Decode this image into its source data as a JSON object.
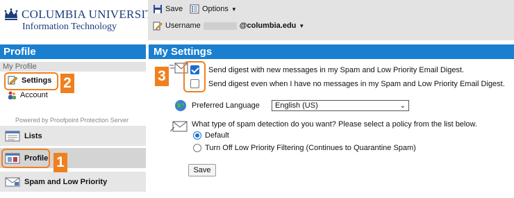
{
  "logo": {
    "university": "COLUMBIA UNIVERSITY",
    "department": "Information Technology",
    "icon": "crown-icon"
  },
  "toolbar": {
    "save_label": "Save",
    "options_label": "Options",
    "username_label": "Username",
    "username_domain": "columbia.edu"
  },
  "sidebar": {
    "header": "Profile",
    "section_label": "My Profile",
    "items": [
      {
        "label": "Settings",
        "icon": "wrench-pencil-icon"
      },
      {
        "label": "Account",
        "icon": "people-icon"
      }
    ],
    "powered_by": "Powered by Proofpoint Protection Server",
    "nav": [
      {
        "label": "Lists",
        "icon": "list-icon"
      },
      {
        "label": "Profile",
        "icon": "profile-icon"
      },
      {
        "label": "Spam and Low Priority",
        "icon": "mail-icon"
      }
    ]
  },
  "settings": {
    "header": "My Settings",
    "digest_option_1": "Send digest with new messages in my Spam and Low Priority Email Digest.",
    "digest_option_1_checked": true,
    "digest_option_2": "Send digest even when I have no messages in my Spam and Low Priority Email Digest.",
    "digest_option_2_checked": false,
    "language_label": "Preferred Language",
    "language_value": "English (US)",
    "spam_question": "What type of spam detection do you want? Please select a policy from the list below.",
    "policy_options": [
      {
        "label": "Default",
        "selected": true
      },
      {
        "label": "Turn Off Low Priority Filtering (Continues to Quarantine Spam)",
        "selected": false
      }
    ],
    "save_label": "Save"
  },
  "callouts": {
    "one": "1",
    "two": "2",
    "three": "3",
    "color": "#f0801e"
  },
  "colors": {
    "header_blue": "#1a7fcf",
    "brand_navy": "#1d3c7a"
  }
}
